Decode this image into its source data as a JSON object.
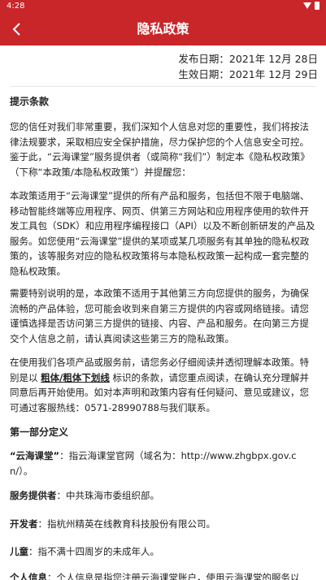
{
  "status_bar": {
    "time": "4:28"
  },
  "app_bar": {
    "title": "隐私政策"
  },
  "dates": {
    "published": "发布日期：2021年 12月 28日",
    "effective": "生效日期：2021年 12月 29日"
  },
  "section_tips": {
    "heading": "提示条款",
    "p1": "您的信任对我们非常重要，我们深知个人信息对您的重要性，我们将按法律法规要求，采取相应安全保护措施，尽力保护您的个人信息安全可控。鉴于此，“云海课堂”服务提供者（或简称“我们”）制定本《隐私权政策》（下称“本政策/本隐私权政策”）并提醒您：",
    "p2": "本政策适用于“云海课堂”提供的所有产品和服务，包括但不限于电脑端、移动智能终端等应用程序、网页、供第三方网站和应用程序使用的软件开发工具包（SDK）和应用程序编程接口（API）以及不断创新研发的产品及服务。如您使用“云海课堂”提供的某项或某几项服务有其单独的隐私权政策的，该等服务对应的隐私权政策将与本隐私权政策一起构成一套完整的隐私权政策。",
    "p3": "需要特别说明的是，本政策不适用于其他第三方向您提供的服务，为确保流畅的产品体验，您可能会收到来自第三方提供的内容或网络链接。请您谨慎选择是否访问第三方提供的链接、内容、产品和服务。在向第三方提交个人信息之前，请认真阅读这些第三方的隐私政策。",
    "p4_pre": "在使用我们各项产品或服务前，请您务必仔细阅读并透彻理解本政策。特别是以 ",
    "p4_bold": "粗体/粗体下划线",
    "p4_post": " 标识的条款，请您重点阅读，在确认充分理解并同意后再开始使用。如对本声明和政策内容有任何疑问、意见或建议，您可通过客服热线：0571-28990788与我们联系。"
  },
  "section_part1": {
    "heading": "第一部分定义",
    "def1_term": "“云海课堂”",
    "def1_text": "：指云海课堂官网（域名为：http://www.zhgbpx.gov.cn/）。",
    "def2_term": "服务提供者",
    "def2_text": "：中共珠海市委组织部。",
    "def3_term": "开发者",
    "def3_text": "：指杭州精英在线教育科技股份有限公司。",
    "def4_term": "儿童",
    "def4_text": "：指不满十四周岁的未成年人。",
    "def5_term": "个人信息",
    "def5_text": "：个人信息是指您注册云海课堂账户，使用云海课堂的服务以"
  }
}
